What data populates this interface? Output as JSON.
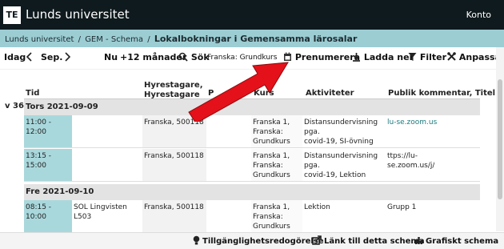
{
  "header": {
    "logo": "TE",
    "title": "Lunds universitet",
    "account": "Konto"
  },
  "breadcrumb": {
    "items": [
      "Lunds universitet",
      "GEM - Schema"
    ],
    "separator": "/",
    "current": "Lokalbokningar i Gemensamma lärosalar"
  },
  "toolbar": {
    "today": "Idag",
    "period": "Sep.",
    "now": "Nu",
    "range": "+12 månader",
    "search": "Sök",
    "search_value": "Franska: Grundkurs",
    "subscribe": "Prenumerera",
    "download": "Ladda ner",
    "filter": "Filter",
    "customize": "Anpassa"
  },
  "table": {
    "columns": {
      "tid": "Tid",
      "host": "Hyrestagare,\nHyrestagare",
      "p": "P",
      "kurs": "Kurs",
      "akt": "Aktiviteter",
      "pub": "Publik kommentar, Titel"
    },
    "week": "v 36",
    "days": [
      {
        "label": "Tors 2021-09-09",
        "rows": [
          {
            "tid": "11:00 - 12:00",
            "room": "",
            "host": "Franska, 500118",
            "kurs": "Franska 1,\nFranska:\nGrundkurs",
            "akt": "Distansundervisning pga.\ncovid-19, SI-övning",
            "pub": "lu-se.zoom.us"
          },
          {
            "tid": "13:15 - 15:00",
            "room": "",
            "host": "Franska, 500118",
            "kurs": "Franska 1,\nFranska:\nGrundkurs",
            "akt": "Distansundervisning pga.\ncovid-19, Lektion",
            "pub": "ttps://lu-\nse.zoom.us/j/"
          }
        ]
      },
      {
        "label": "Fre 2021-09-10",
        "rows": [
          {
            "tid": "08:15 - 10:00",
            "room": "SOL Lingvisten L503",
            "host": "Franska, 500118",
            "kurs": "Franska 1,\nFranska:\nGrundkurs",
            "akt": "Lektion",
            "pub": "Grupp 1"
          }
        ]
      }
    ]
  },
  "footer": {
    "accessibility": "Tillgänglighetsredogörelse",
    "link": "Länk till detta schema",
    "graphic": "Grafiskt schema"
  },
  "colors": {
    "topbar": "#0f1a1e",
    "breadcrumb": "#9ccdd3",
    "time_cell": "#a9d8dc",
    "arrow": "#e4111a",
    "link": "#1d7a7e"
  }
}
